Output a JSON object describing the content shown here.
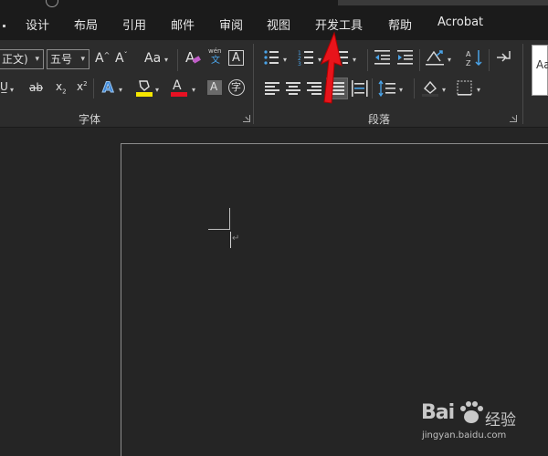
{
  "menu": {
    "tabs": [
      {
        "label": "设计"
      },
      {
        "label": "布局"
      },
      {
        "label": "引用"
      },
      {
        "label": "邮件"
      },
      {
        "label": "审阅"
      },
      {
        "label": "视图"
      },
      {
        "label": "开发工具"
      },
      {
        "label": "帮助"
      },
      {
        "label": "Acrobat"
      }
    ]
  },
  "ribbon": {
    "font_group": {
      "font_name": "正文)",
      "font_size": "五号",
      "grow_font": "A",
      "shrink_font": "A",
      "change_case": "Aa",
      "pinyin_top": "wén",
      "pinyin_bottom": "文",
      "border_char": "A",
      "strikethrough": "ab",
      "subscript": "x",
      "subscript_mark": "2",
      "superscript": "x",
      "superscript_mark": "2",
      "text_effects": "A",
      "font_color": "A",
      "shading_char": "A",
      "enclose_char": "字",
      "label": "字体"
    },
    "paragraph_group": {
      "label": "段落"
    },
    "styles_group": {
      "preview": "Aa"
    },
    "colors": {
      "highlight": "#f5e600",
      "font_color": "#e81123",
      "text_effect": "#3b86d8"
    }
  },
  "watermark": {
    "brand": "Bai",
    "brand_suffix": "经验",
    "url": "jingyan.baidu.com"
  },
  "annotation": {
    "arrow_color": "#e8141b"
  }
}
